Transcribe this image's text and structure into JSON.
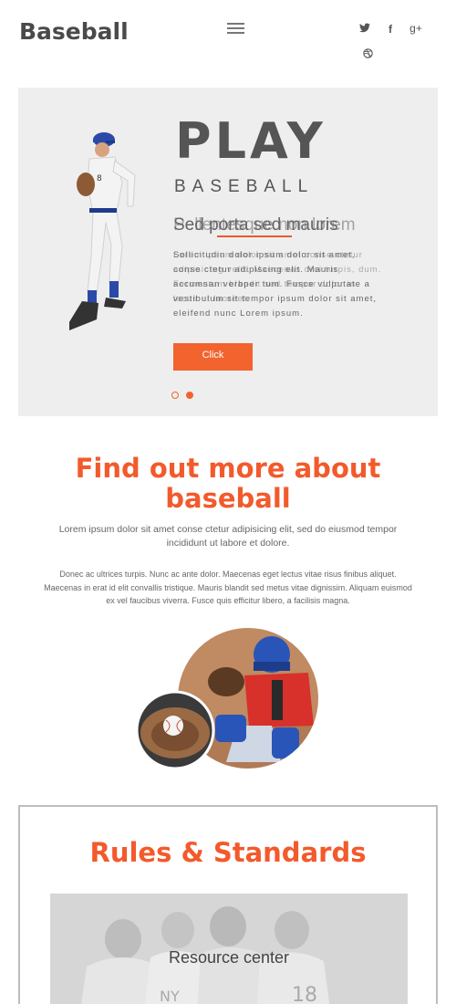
{
  "header": {
    "logo": "Baseball",
    "social": [
      {
        "icon": "twitter-icon",
        "glyph": "t"
      },
      {
        "icon": "facebook-icon",
        "glyph": "f"
      },
      {
        "icon": "google-plus-icon",
        "glyph": "g+"
      },
      {
        "icon": "dribbble-icon",
        "glyph": "◎"
      }
    ]
  },
  "hero": {
    "title": "PLAY",
    "subtitle": "BASEBALL",
    "tagline_a": "Sed porta sed mauris",
    "tagline_b": "Pellentesque non lorem",
    "text_a": "Sollicitudin dolor ipsum dolor sit amet, conse ctetur adipiscing elit. Mauris accumsan verbper tum. Fusce vulputate a vestibulum sit tempor ipsum dolor sit amet, eleifend nunc Lorem ipsum.",
    "text_b": "Lorem ipsum dolor sit amet conse ctetur adipisicing velit. Maecenas orci turpis, dum. Fermentum blandit sed tempor dolor in lacus ut laoreet.",
    "button_label": "Click",
    "slide_count": 2,
    "active_slide": 2
  },
  "about": {
    "title_line1": "Find out more about",
    "title_line2": "baseball",
    "lead": "Lorem ipsum dolor sit amet conse ctetur adipisicing elit, sed do eiusmod tempor incididunt ut labore et dolore.",
    "body": "Donec ac ultrices turpis. Nunc ac ante dolor. Maecenas eget lectus vitae risus finibus aliquet. Maecenas in erat id elit convallis tristique. Mauris blandit sed metus vitae dignissim. Aliquam euismod ex vel faucibus viverra. Fusce quis efficitur libero, a facilisis magna."
  },
  "rules": {
    "title": "Rules & Standards",
    "resource_caption": "Resource center"
  },
  "colors": {
    "accent": "#f25a2c",
    "hero_bg": "#eeeeee",
    "text": "#666666",
    "logo": "#4a4a4a"
  }
}
